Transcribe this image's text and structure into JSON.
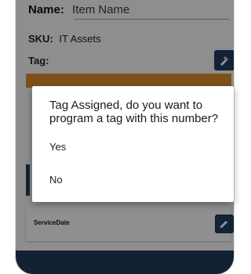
{
  "form": {
    "name_label": "Name:",
    "name_value": "Item Name",
    "sku_label": "SKU:",
    "sku_value": "IT Assets",
    "tag_label": "Tag:",
    "service_date_label": "ServiceDate"
  },
  "dialog": {
    "message": "Tag Assigned, do you want to program a tag with this number?",
    "options": [
      "Yes",
      "No"
    ]
  },
  "icons": {
    "tag_button": "tag-assign-icon",
    "edit_button": "pencil-icon"
  },
  "colors": {
    "accent": "#1e3d5c",
    "tag_highlight": "#d98c2b",
    "bottom_bar": "#213b58"
  }
}
